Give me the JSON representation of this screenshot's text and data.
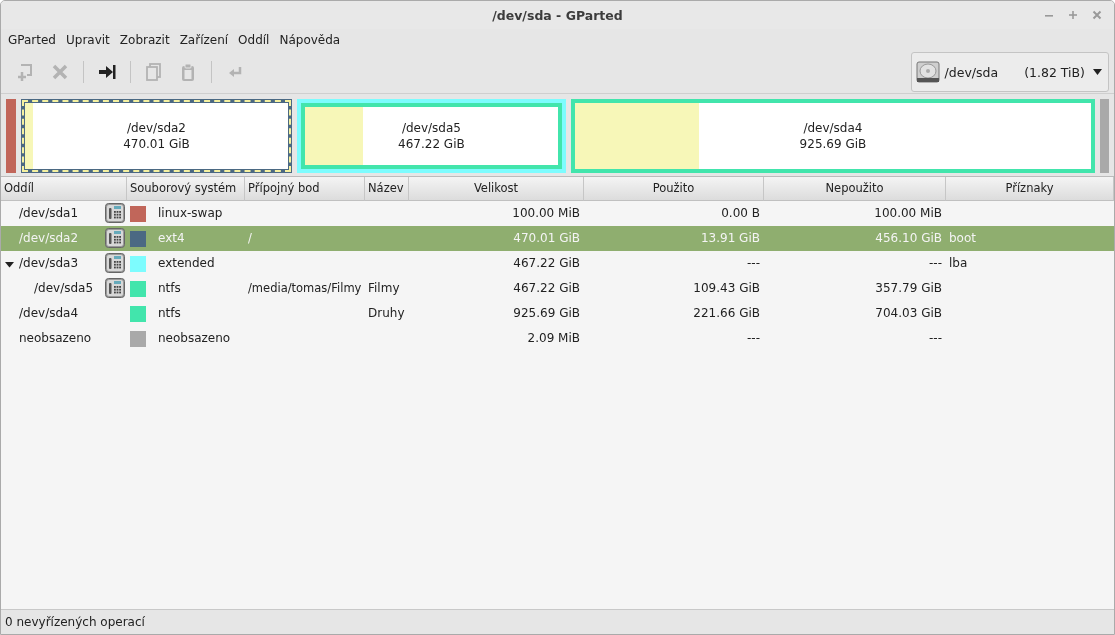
{
  "window": {
    "title": "/dev/sda - GParted"
  },
  "menu": [
    "GParted",
    "Upravit",
    "Zobrazit",
    "Zařízení",
    "Oddíl",
    "Nápověda"
  ],
  "toolbar": [
    {
      "kind": "new",
      "disabled": true
    },
    {
      "kind": "delete",
      "disabled": true
    },
    {
      "kind": "sep"
    },
    {
      "kind": "resize",
      "disabled": false
    },
    {
      "kind": "sep"
    },
    {
      "kind": "copy",
      "disabled": true
    },
    {
      "kind": "paste",
      "disabled": true
    },
    {
      "kind": "sep"
    },
    {
      "kind": "apply",
      "disabled": true
    }
  ],
  "device": {
    "name": "/dev/sda",
    "size": "(1.82 TiB)"
  },
  "disk_map": [
    {
      "kind": "small",
      "color": "#c1665a"
    },
    {
      "kind": "primary",
      "name": "/dev/sda2",
      "size": "470.01 GiB",
      "color": "#4b6983",
      "level": 0.03,
      "selected": true
    },
    {
      "kind": "extended",
      "color": "#7dfcfe",
      "children": [
        {
          "kind": "primary",
          "name": "/dev/sda5",
          "size": "467.22 GiB",
          "color": "#42e5ac",
          "level": 0.23,
          "selected": false
        }
      ]
    },
    {
      "kind": "primary",
      "name": "/dev/sda4",
      "size": "925.69 GiB",
      "color": "#42e5ac",
      "level": 0.24,
      "selected": false
    },
    {
      "kind": "small",
      "color": "#a9a9a9"
    }
  ],
  "table": {
    "columns": [
      "Oddíl",
      "Souborový systém",
      "Přípojný bod",
      "Název",
      "Velikost",
      "Použito",
      "Nepoužito",
      "Příznaky"
    ],
    "rows": [
      {
        "partition": "/dev/sda1",
        "locked": true,
        "color": "#c1665a",
        "filesystem": "linux-swap",
        "size": "100.00 MiB",
        "used": "0.00 B",
        "unused": "100.00 MiB",
        "selected": false
      },
      {
        "partition": "/dev/sda2",
        "locked": true,
        "color": "#4b6983",
        "filesystem": "ext4",
        "mount": "/",
        "size": "470.01 GiB",
        "used": "13.91 GiB",
        "unused": "456.10 GiB",
        "flags": "boot",
        "selected": true
      },
      {
        "partition": "/dev/sda3",
        "locked": true,
        "color": "#7dfcfe",
        "filesystem": "extended",
        "size": "467.22 GiB",
        "used": "---",
        "unused": "---",
        "flags": "lba",
        "selected": false,
        "expanded": true,
        "children": [
          {
            "partition": "/dev/sda5",
            "locked": true,
            "color": "#42e5ac",
            "filesystem": "ntfs",
            "mount": "/media/tomas/Filmy",
            "label": "Filmy",
            "size": "467.22 GiB",
            "used": "109.43 GiB",
            "unused": "357.79 GiB",
            "selected": false
          }
        ]
      },
      {
        "partition": "/dev/sda4",
        "locked": false,
        "color": "#42e5ac",
        "filesystem": "ntfs",
        "label": "Druhy",
        "size": "925.69 GiB",
        "used": "221.66 GiB",
        "unused": "704.03 GiB",
        "selected": false
      },
      {
        "partition": "neobsazeno",
        "locked": false,
        "color": "#a9a9a9",
        "filesystem": "neobsazeno",
        "size": "2.09 MiB",
        "used": "---",
        "unused": "---",
        "selected": false
      }
    ]
  },
  "status_bar": "0 nevyřízených operací"
}
